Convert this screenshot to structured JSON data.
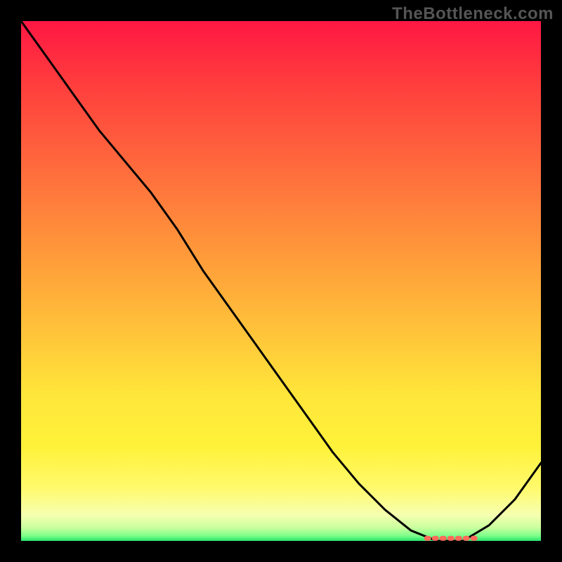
{
  "watermark_text": "TheBottleneck.com",
  "chart_data": {
    "type": "line",
    "title": "",
    "xlabel": "",
    "ylabel": "",
    "x": [
      0.0,
      0.05,
      0.1,
      0.15,
      0.2,
      0.25,
      0.3,
      0.35,
      0.4,
      0.45,
      0.5,
      0.55,
      0.6,
      0.65,
      0.7,
      0.75,
      0.8,
      0.85,
      0.9,
      0.95,
      1.0
    ],
    "values": [
      1.0,
      0.93,
      0.86,
      0.79,
      0.73,
      0.67,
      0.6,
      0.52,
      0.45,
      0.38,
      0.31,
      0.24,
      0.17,
      0.11,
      0.06,
      0.02,
      0.0,
      0.0,
      0.03,
      0.08,
      0.15
    ],
    "ylim": [
      0,
      1
    ],
    "xlim": [
      0,
      1
    ],
    "marker_region": {
      "x_start": 0.78,
      "x_end": 0.88,
      "y": 0.005
    },
    "gradient_stops": [
      {
        "offset": 0.0,
        "color": "#ff1744"
      },
      {
        "offset": 0.12,
        "color": "#ff3d3d"
      },
      {
        "offset": 0.28,
        "color": "#ff6a3d"
      },
      {
        "offset": 0.45,
        "color": "#ff9a3a"
      },
      {
        "offset": 0.6,
        "color": "#ffc43a"
      },
      {
        "offset": 0.72,
        "color": "#ffe63a"
      },
      {
        "offset": 0.82,
        "color": "#fff23a"
      },
      {
        "offset": 0.9,
        "color": "#fffa6e"
      },
      {
        "offset": 0.95,
        "color": "#f6ffb0"
      },
      {
        "offset": 0.975,
        "color": "#c8ff9e"
      },
      {
        "offset": 0.99,
        "color": "#7dff8a"
      },
      {
        "offset": 1.0,
        "color": "#27e36b"
      }
    ],
    "curve_color": "#000000",
    "marker_color": "#ff6a5a"
  }
}
